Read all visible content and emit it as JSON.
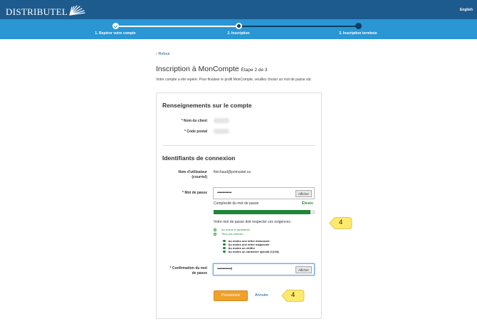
{
  "header": {
    "logo_text": "DISTRIBUTEL",
    "language_link": "English"
  },
  "steps": [
    {
      "label": "1. Repérer votre compte",
      "state": "done"
    },
    {
      "label": "2. Inscription",
      "state": "current"
    },
    {
      "label": "3. Inscription terminée",
      "state": "todo"
    }
  ],
  "page": {
    "back_link": "‹ Retour",
    "title": "Inscription à MonCompte",
    "step_indicator": "Étape 2 de 3",
    "intro": "Votre compte a été repéré. Pour finaliser le profil MonCompte, veuillez choisir un mot de passe sûr."
  },
  "account": {
    "heading": "Renseignements sur le compte",
    "client_name_label": "* Nom du client",
    "postal_code_label": "* Code postal"
  },
  "login": {
    "heading": "Identifiants de connexion",
    "username_label_1": "Nom d'utilisateur",
    "username_label_2": "(courriel)",
    "username_value": "finichaud@primustel.ca",
    "password_label": "* Mot de passe",
    "password_value": "••••••••••••••••",
    "show_button": "Afficher",
    "strength_label": "Complexité du mot de passe",
    "strength_value": "Élevée",
    "strength_fraction": 0.95,
    "requirements_intro": "Votre mot de passe doit respecter ces exigences :",
    "min_chars": "Au moins 8 caractères",
    "all_criteria": "Tous ces critères :",
    "rules": [
      "Au moins une lettre minuscule",
      "Au moins une lettre majuscule",
      "Au moins un chiffre",
      "Au moins un caractère spécial (!@#$)"
    ],
    "confirm_label_1": "* Confirmation du mot",
    "confirm_label_2": "de passe",
    "confirm_value": "••••••••••••••••|",
    "show_button_2": "Afficher"
  },
  "actions": {
    "continue": "Poursuivre",
    "cancel": "Annuler"
  },
  "callouts": [
    "4",
    "4"
  ],
  "colors": {
    "header": "#1d5b8e",
    "stepbar": "#2a96d3",
    "success": "#22863a",
    "button": "#f0a12a",
    "callout": "#fde96b"
  }
}
